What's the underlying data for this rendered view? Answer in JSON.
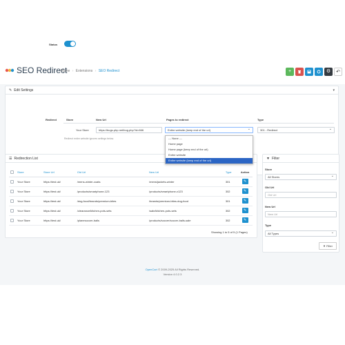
{
  "header": {
    "title": "SEO Redirect",
    "breadcrumbs": [
      "Home",
      "Extensions",
      "SEO Redirect"
    ]
  },
  "toolbar": {
    "add_icon": "plus-icon",
    "delete_icon": "trash-icon",
    "save_icon": "floppy-icon",
    "refresh_icon": "refresh-icon",
    "settings_icon": "gear-icon",
    "back_icon": "reply-icon"
  },
  "colors": {
    "primary": "#1e91cf",
    "success": "#5cb85c",
    "danger": "#d9534f",
    "selected_option": "#2b65c4",
    "dark": "#343a40"
  },
  "edit_settings": {
    "heading": "Edit Settings",
    "status_label": "Status",
    "status_on": true,
    "redirect_label": "Redirect",
    "col_store": "Store",
    "col_new_url": "New Url",
    "col_pages": "Pages to redirect",
    "col_type": "Type",
    "store_value": "Your Store",
    "new_url_value": "https://bugs.php.net/bug.php?id=666",
    "pages_value": "Entire website (keep end of the url)",
    "type_value": "301 - Redirect",
    "help_text": "Redirect entire website ignores settings below.",
    "pages_options": [
      "--- None ---",
      "Home page",
      "Home page (keep end of the url)",
      "Entire website",
      "Entire website (keep end of the url)"
    ]
  },
  "redirection_list": {
    "heading": "Redirection List",
    "columns": [
      "Store",
      "Store Url",
      "Old Url",
      "New Url",
      "Type",
      "Action"
    ],
    "rows": [
      [
        "Your Store",
        "https://test.uk/",
        "/mens-winter-coats",
        "/mens/jackets-winter",
        "301"
      ],
      [
        "Your Store",
        "https://test.uk/",
        "/products/smartphone-123",
        "/products/smartphone-x123",
        "302"
      ],
      [
        "Your Store",
        "https://test.uk/",
        "/dog-food/brands/premium-bites",
        "/brands/premium-bites-dog-food",
        "301"
      ],
      [
        "Your Store",
        "https://test.uk/",
        "/clearance/kitchen-pots-sets",
        "/sale/kitchen-pots-sets",
        "302"
      ],
      [
        "Your Store",
        "https://test.uk/",
        "/planesoccer-balls",
        "/products/soccer/soccer-balls-sale",
        "302"
      ]
    ],
    "pagination_text": "Showing 1 to 5 of 5 (1 Pages)"
  },
  "filter": {
    "heading": "Filter",
    "store_label": "Store",
    "store_value": "All Stores",
    "old_url_label": "Old Url",
    "old_url_placeholder": "Old Url",
    "new_url_label": "New Url",
    "new_url_placeholder": "New Url",
    "type_label": "Type",
    "type_value": "All Types",
    "button_label": "Filter"
  },
  "footer": {
    "brand": "OpenCart",
    "copyright": "© 2009-2025 All Rights Reserved.",
    "version": "Version 4.0.2.3"
  }
}
